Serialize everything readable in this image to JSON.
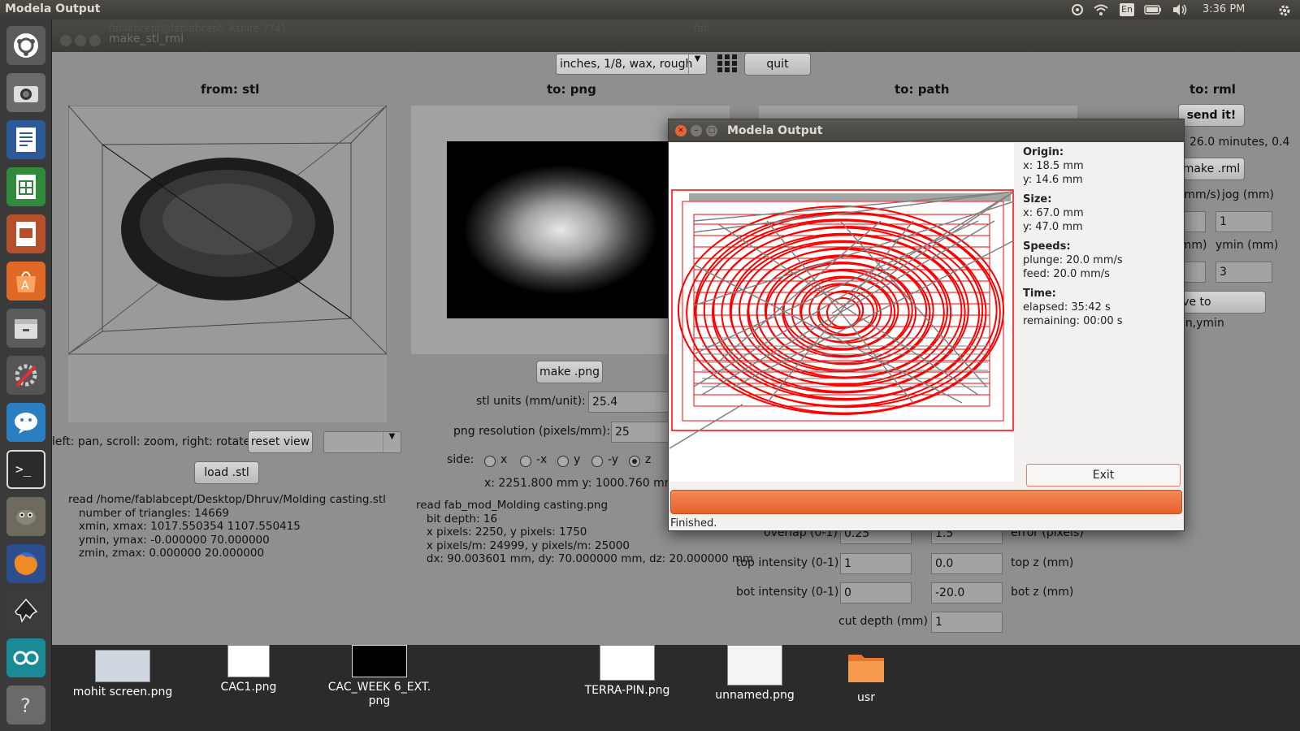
{
  "topbar": {
    "title": "Modela Output",
    "lang": "En",
    "time": "3:36 PM"
  },
  "app": {
    "window_title": "make_stl_rml",
    "ghost_title_left": "fablabcept@fablabcept: Aspire 7741",
    "ghost_title_right": "fab",
    "preset": "inches, 1/8, wax, rough",
    "quit": "quit",
    "col_stl": "from: stl",
    "col_png": "to: png",
    "col_path": "to: path",
    "col_rml": "to: rml",
    "stl": {
      "hint": "left: pan, scroll: zoom, right: rotate",
      "reset_view": "reset view",
      "load": "load .stl",
      "info": "read /home/fablabcept/Desktop/Dhruv/Molding casting.stl\n   number of triangles: 14669\n   xmin, xmax: 1017.550354 1107.550415\n   ymin, ymax: -0.000000 70.000000\n   zmin, zmax: 0.000000 20.000000"
    },
    "png": {
      "make": "make .png",
      "units_label": "stl units (mm/unit):",
      "units_value": "25.4",
      "res_label": "png resolution (pixels/mm):",
      "res_value": "25",
      "side_label": "side:",
      "sides": [
        "x",
        "-x",
        "y",
        "-y",
        "z"
      ],
      "side_selected": "z",
      "dims": "x: 2251.800 mm  y: 1000.760 mm",
      "info": "read fab_mod_Molding casting.png\n   bit depth: 16\n   x pixels: 2250, y pixels: 1750\n   x pixels/m: 24999, y pixels/m: 25000\n   dx: 90.003601 mm, dy: 70.000000 mm, dz: 20.000000 mm"
    },
    "path": {
      "overlap_label": "overlap (0-1)",
      "overlap_value": "0.25",
      "error_value": "1.5",
      "error_label": "error (pixels)",
      "top_int_label": "top intensity (0-1)",
      "top_int_value": "1",
      "top_z_value": "0.0",
      "top_z_label": "top z (mm)",
      "bot_int_label": "bot intensity (0-1)",
      "bot_int_value": "0",
      "bot_z_value": "-20.0",
      "bot_z_label": "bot z (mm)",
      "cut_depth_label": "cut depth (mm)",
      "cut_depth_value": "1"
    },
    "rml": {
      "send": "send it!",
      "estimate": "nds, 26.0 minutes, 0.4",
      "make": "make .rml",
      "speed_label": "ed (mm/s)",
      "jog_label": "jog (mm)",
      "jog_value": "1",
      "xmin_label": "in (mm)",
      "ymin_label": "ymin (mm)",
      "ymin_value": "3",
      "move": "move to xmin,ymin"
    }
  },
  "modela": {
    "title": "Modela Output",
    "origin_h": "Origin:",
    "origin_x": "x: 18.5 mm",
    "origin_y": "y: 14.6 mm",
    "size_h": "Size:",
    "size_x": "x: 67.0 mm",
    "size_y": "y: 47.0 mm",
    "speeds_h": "Speeds:",
    "plunge": "plunge: 20.0 mm/s",
    "feed": "feed: 20.0 mm/s",
    "time_h": "Time:",
    "elapsed": "elapsed: 35:42 s",
    "remaining": "remaining: 00:00 s",
    "exit": "Exit",
    "status": "Finished.",
    "progress": 1.0,
    "path_color": "#ff0000",
    "travel_color": "#808080"
  },
  "desktop": {
    "icons": [
      "mohit screen.png",
      "CAC1.png",
      "CAC_WEEK 6_EXT.\npng",
      "TERRA-PIN.png",
      "unnamed.png",
      "usr"
    ]
  },
  "launcher": {
    "icons": [
      "ubuntu-dash-icon",
      "camera-icon",
      "writer-icon",
      "calc-icon",
      "impress-icon",
      "software-center-icon",
      "files-icon",
      "settings-icon",
      "pidgin-icon",
      "terminal-icon",
      "gimp-icon",
      "firefox-icon",
      "inkscape-icon",
      "arduino-icon",
      "help-icon"
    ]
  }
}
